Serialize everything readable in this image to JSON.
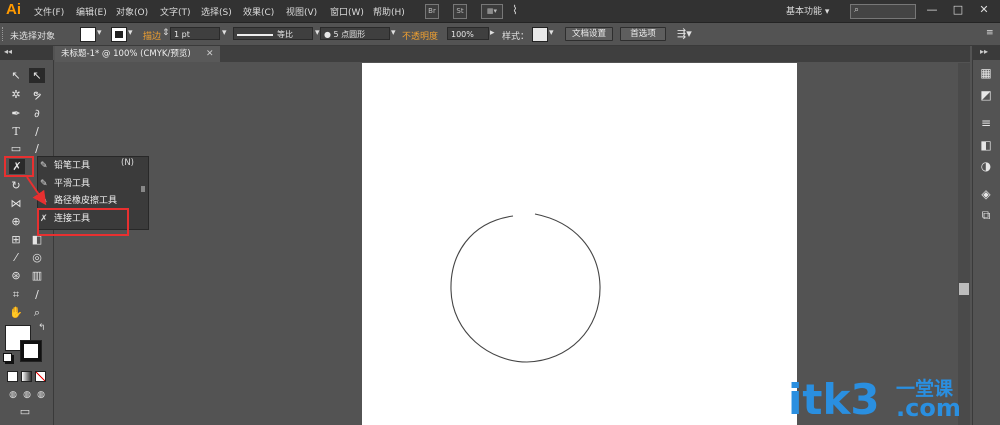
{
  "app": {
    "logo": "Ai"
  },
  "menu": [
    "文件(F)",
    "编辑(E)",
    "对象(O)",
    "文字(T)",
    "选择(S)",
    "效果(C)",
    "视图(V)",
    "窗口(W)",
    "帮助(H)"
  ],
  "menubar_icons": {
    "br": "Br",
    "st": "St"
  },
  "workspace": {
    "label": "基本功能",
    "chevron": "▾"
  },
  "window_controls": {
    "minimize": "—",
    "restore": "□",
    "close": "✕"
  },
  "control_bar": {
    "selection_status": "未选择对象",
    "stroke_label": "描边",
    "stroke_weight": "1 pt",
    "stroke_profile": "等比",
    "brush": "5 点圆形",
    "opacity_label": "不透明度",
    "opacity_value": "100%",
    "style_label": "样式",
    "doc_setup_button": "文档设置",
    "preferences_button": "首选项"
  },
  "document_tab": {
    "title": "未标题-1* @ 100% (CMYK/预览)",
    "close": "✕"
  },
  "flyout": {
    "items": [
      {
        "label": "铅笔工具",
        "shortcut": "(N)"
      },
      {
        "label": "平滑工具"
      },
      {
        "label": "路径橡皮擦工具"
      },
      {
        "label": "连接工具"
      }
    ]
  },
  "watermark": {
    "text": "itk3",
    "suffix": "一堂课",
    "domain": ".com"
  },
  "colors": {
    "accent_orange": "#ff9a00",
    "highlight_red": "#e83030",
    "watermark_blue": "#2a8fe0"
  }
}
